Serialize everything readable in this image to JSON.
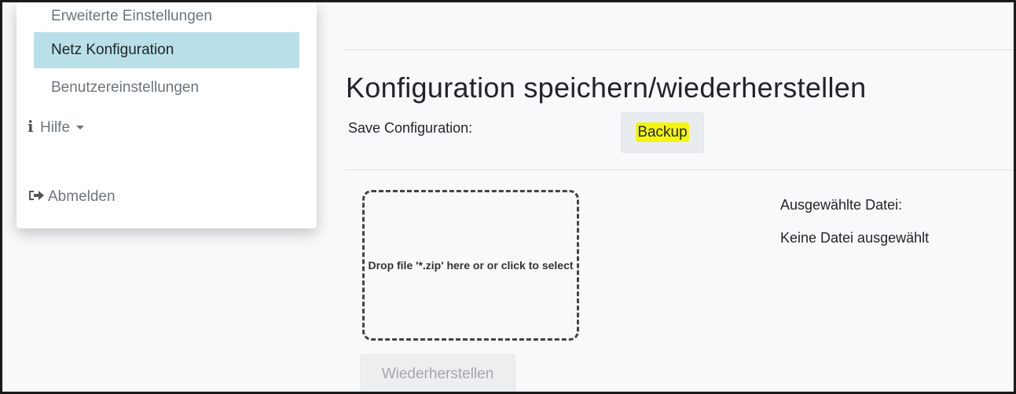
{
  "menu": {
    "items": [
      {
        "label": "Erweiterte Einstellungen"
      },
      {
        "label": "Netz Konfiguration",
        "active": true
      },
      {
        "label": "Benutzereinstellungen"
      },
      {
        "label": "Hilfe",
        "icon": "info-icon",
        "dropdown": true
      },
      {
        "label": "Abmelden",
        "icon": "sign-out-icon"
      }
    ]
  },
  "main": {
    "title": "Konfiguration speichern/wiederherstellen",
    "save_label": "Save Configuration:",
    "backup_button": "Backup",
    "dropzone_text": "Drop file '*.zip' here or or click to select",
    "selected_file_label": "Ausgewählte Datei:",
    "selected_file_value": "Keine Datei ausgewählt",
    "restore_button": "Wiederherstellen"
  },
  "colors": {
    "active_item_bg": "#b9e0e8",
    "highlight": "#f3f50f",
    "page_bg": "#f8f9fa"
  }
}
